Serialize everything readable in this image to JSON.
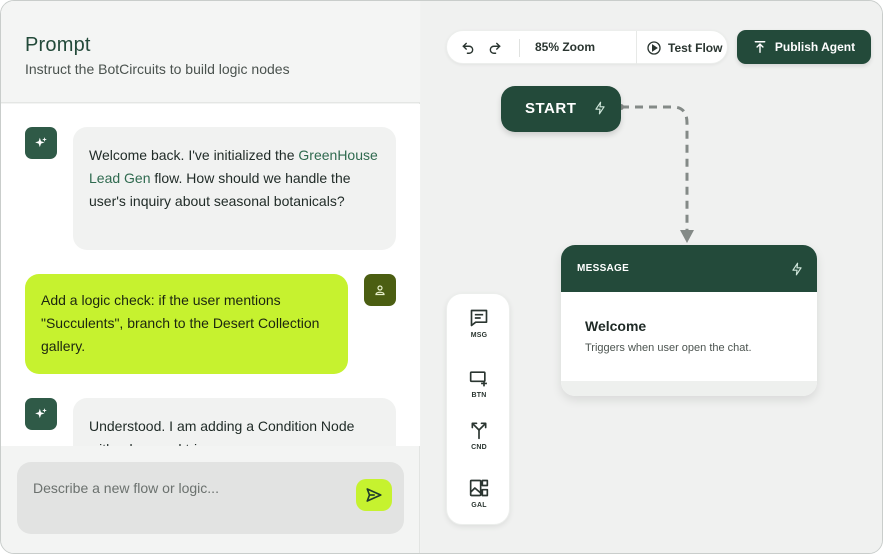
{
  "prompt_panel": {
    "title": "Prompt",
    "subtitle": "Instruct the BotCircuits to build logic nodes"
  },
  "chat": {
    "messages": [
      {
        "role": "bot",
        "text_before": "Welcome back. I've initialized the ",
        "highlight": "GreenHouse Lead Gen",
        "text_after": " flow. How should we handle the user's inquiry about seasonal botanicals?"
      },
      {
        "role": "user",
        "text": "Add a logic check: if the user mentions \"Succulents\", branch to the Desert Collection gallery."
      },
      {
        "role": "bot",
        "text": "Understood. I am adding a Condition Node with a keyword trigger..."
      }
    ]
  },
  "composer": {
    "placeholder": "Describe a new flow or logic...",
    "value": ""
  },
  "toolbar": {
    "zoom_label": "85% Zoom",
    "test_flow_label": "Test Flow",
    "publish_label": "Publish Agent"
  },
  "canvas": {
    "start_node": {
      "label": "START"
    },
    "message_node": {
      "type_label": "MESSAGE",
      "title": "Welcome",
      "description": "Triggers when user open the chat."
    },
    "palette": [
      {
        "label": "MSG",
        "icon": "message-square-icon"
      },
      {
        "label": "BTN",
        "icon": "button-add-icon"
      },
      {
        "label": "CND",
        "icon": "branch-icon"
      },
      {
        "label": "GAL",
        "icon": "gallery-icon"
      }
    ]
  },
  "colors": {
    "brand_dark": "#234a3a",
    "accent_lime": "#c6f22f",
    "user_avatar": "#4b5e12"
  }
}
